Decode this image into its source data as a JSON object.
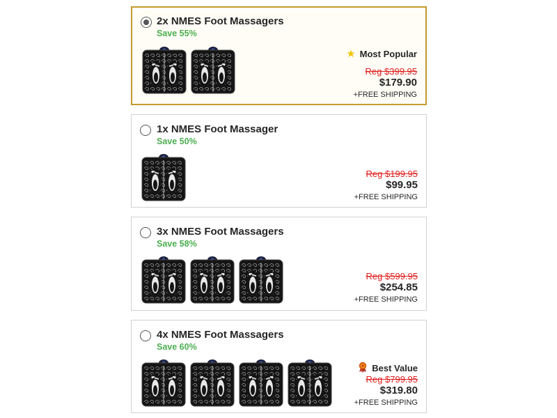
{
  "offers": [
    {
      "title": "2x NMES Foot Massagers",
      "save": "Save 55%",
      "selected": true,
      "pad_count": 2,
      "badge": {
        "label": "Most Popular",
        "icon": "star-icon"
      },
      "reg_price": "Reg $399.95",
      "price": "$179.90",
      "shipping": "+FREE SHIPPING"
    },
    {
      "title": "1x NMES Foot Massager",
      "save": "Save 50%",
      "selected": false,
      "pad_count": 1,
      "badge": null,
      "reg_price": "Reg $199.95",
      "price": "$99.95",
      "shipping": "+FREE SHIPPING"
    },
    {
      "title": "3x NMES Foot Massagers",
      "save": "Save 58%",
      "selected": false,
      "pad_count": 3,
      "badge": null,
      "reg_price": "Reg $599.95",
      "price": "$254.85",
      "shipping": "+FREE SHIPPING"
    },
    {
      "title": "4x NMES Foot Massagers",
      "save": "Save 60%",
      "selected": false,
      "pad_count": 4,
      "badge": {
        "label": "Best Value",
        "icon": "award-ribbon-icon"
      },
      "reg_price": "Reg $799.95",
      "price": "$319.80",
      "shipping": "+FREE SHIPPING"
    }
  ],
  "colors": {
    "selected_border": "#c49a2c",
    "save_green": "#4caf50",
    "reg_red": "#e02020",
    "star_yellow": "#f2c400"
  }
}
